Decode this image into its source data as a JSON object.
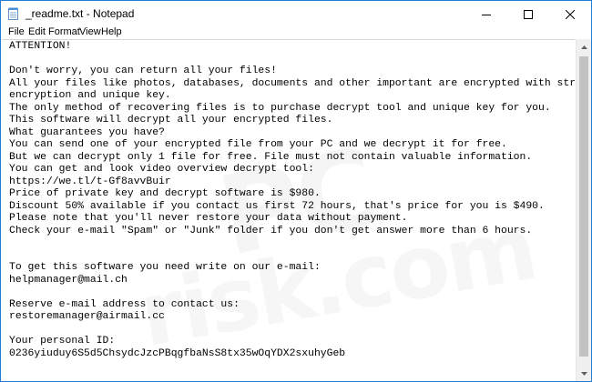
{
  "window": {
    "title": "_readme.txt - Notepad",
    "accent_color": "#1e7cd6",
    "app_icon": "notepad-icon",
    "controls": [
      "minimize-icon",
      "maximize-icon",
      "close-icon"
    ]
  },
  "menu": {
    "file": "File",
    "edit": "Edit",
    "format": "Format",
    "view": "View",
    "help": "Help"
  },
  "document": {
    "lines": [
      "ATTENTION!",
      "",
      "Don't worry, you can return all your files!",
      "All your files like photos, databases, documents and other important are encrypted with strongest",
      "encryption and unique key.",
      "The only method of recovering files is to purchase decrypt tool and unique key for you.",
      "This software will decrypt all your encrypted files.",
      "What guarantees you have?",
      "You can send one of your encrypted file from your PC and we decrypt it for free.",
      "But we can decrypt only 1 file for free. File must not contain valuable information.",
      "You can get and look video overview decrypt tool:",
      "https://we.tl/t-Gf8avvBuir",
      "Price of private key and decrypt software is $980.",
      "Discount 50% available if you contact us first 72 hours, that's price for you is $490.",
      "Please note that you'll never restore your data without payment.",
      "Check your e-mail \"Spam\" or \"Junk\" folder if you don't get answer more than 6 hours.",
      "",
      "",
      "To get this software you need write on our e-mail:",
      "helpmanager@mail.ch",
      "",
      "Reserve e-mail address to contact us:",
      "restoremanager@airmail.cc",
      "",
      "Your personal ID:",
      "0236yiuduy6S5d5ChsydcJzcPBqgfbaNsS8tx35wOqYDX2sxuhyGeb"
    ]
  },
  "watermark": {
    "line1": "PC",
    "line2": "risk.com"
  }
}
